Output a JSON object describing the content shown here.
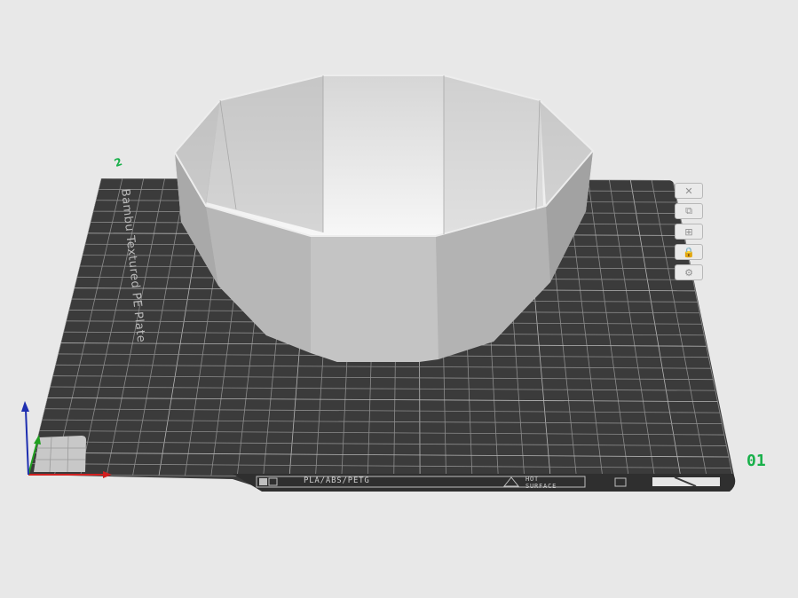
{
  "plate": {
    "name_text": "Bambu Textured PE Plate",
    "plate_number": "01",
    "corner_mark": "2",
    "filament_types": "PLA/ABS/PETG",
    "surface_label_line1": "HOT",
    "surface_label_line2": "SURFACE"
  },
  "toolbar": [
    {
      "icon": "close-icon",
      "glyph": "✕"
    },
    {
      "icon": "auto-arrange-icon",
      "glyph": "⧉"
    },
    {
      "icon": "orient-icon",
      "glyph": "⊞"
    },
    {
      "icon": "lock-icon",
      "glyph": "🔒"
    },
    {
      "icon": "settings-icon",
      "glyph": "⚙"
    }
  ],
  "colors": {
    "background": "#e8e8e8",
    "plate": "#3b3b3b",
    "grid": "#8a8a8a",
    "model": "#c8c8c8",
    "axis_x": "#d02020",
    "axis_y": "#20a020",
    "axis_z": "#1e2fb0",
    "accent": "#18b04a"
  }
}
